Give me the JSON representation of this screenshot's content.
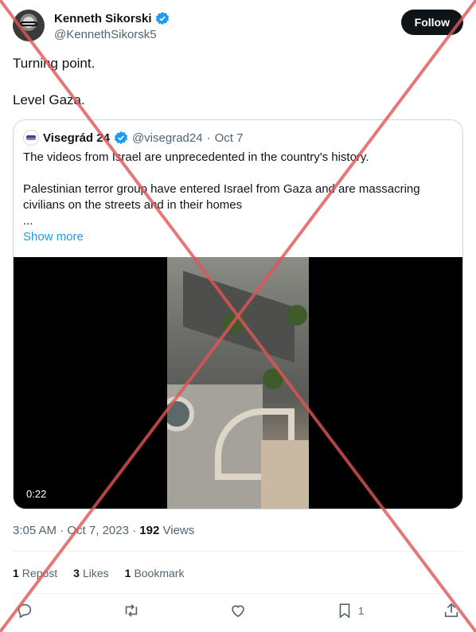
{
  "author": {
    "display_name": "Kenneth Sikorski",
    "handle": "@KennethSikorsk5",
    "follow_label": "Follow"
  },
  "tweet": {
    "line1": "Turning point.",
    "line2": "Level Gaza."
  },
  "quoted": {
    "display_name": "Visegrád 24",
    "handle": "@visegrad24",
    "separator": "·",
    "date": "Oct 7",
    "paragraph1": "The videos from Israel are unprecedented in the country's history.",
    "paragraph2": "Palestinian terror group have entered Israel from Gaza and are massacring civilians on the streets and in their homes",
    "ellipsis": "...",
    "show_more_label": "Show more",
    "video_duration": "0:22"
  },
  "meta": {
    "time": "3:05 AM",
    "separator": "·",
    "date": "Oct 7, 2023",
    "views_count": "192",
    "views_label": "Views"
  },
  "stats": {
    "reposts_count": "1",
    "reposts_label": "Repost",
    "likes_count": "3",
    "likes_label": "Likes",
    "bookmarks_count": "1",
    "bookmarks_label": "Bookmark"
  },
  "actions": {
    "bookmark_count": "1"
  },
  "colors": {
    "accent": "#1d9bf0",
    "follow_button": "#0f1419",
    "overlay_cross": "#e05555"
  },
  "icons": [
    "verified-badge-icon",
    "reply-icon",
    "retweet-icon",
    "like-icon",
    "bookmark-icon",
    "share-icon"
  ]
}
